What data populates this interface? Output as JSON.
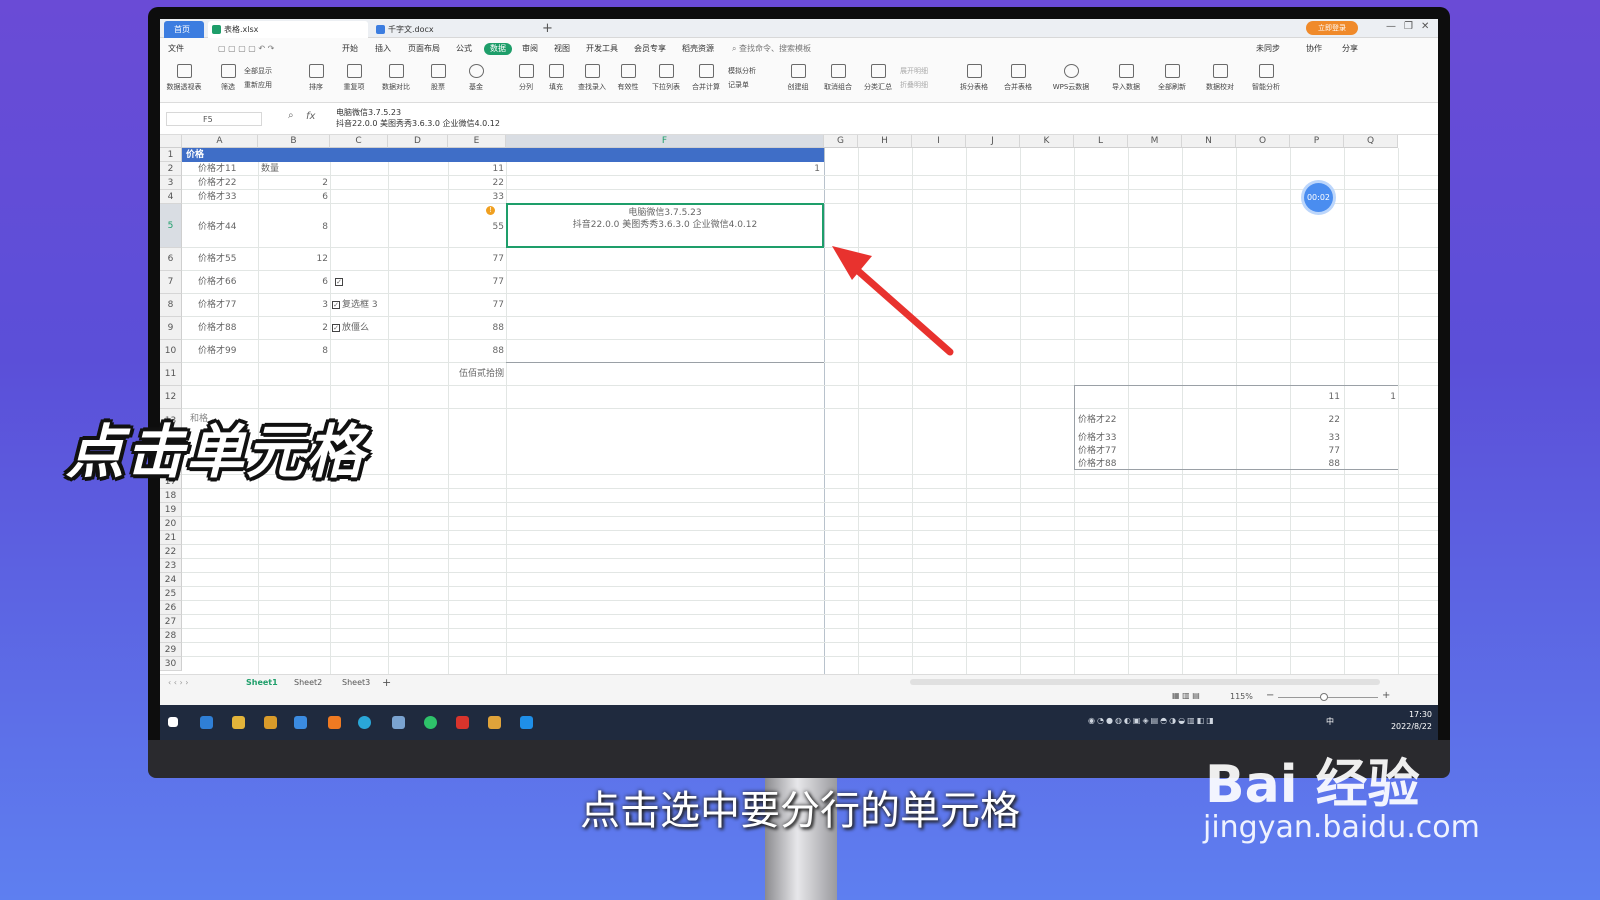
{
  "tabs": {
    "home": "首页",
    "xlsx": "表格.xlsx",
    "docx": "千字文.docx",
    "new_tab": "+"
  },
  "login": "立即登录",
  "menu": [
    "文件",
    "开始",
    "插入",
    "页面布局",
    "公式",
    "数据",
    "审阅",
    "视图",
    "开发工具",
    "会员专享",
    "稻壳资源"
  ],
  "menu_search": "查找命令、搜索模板",
  "menu_right": [
    "未同步",
    "协作",
    "分享"
  ],
  "ribbon": [
    "数据透视表",
    "筛选",
    "全部显示",
    "重新应用",
    "排序",
    "重复项",
    "数据对比",
    "股票",
    "基金",
    "分列",
    "填充",
    "查找录入",
    "有效性",
    "下拉列表",
    "合并计算",
    "模拟分析",
    "记录单",
    "创建组",
    "取消组合",
    "分类汇总",
    "展开明细",
    "折叠明细",
    "拆分表格",
    "合并表格",
    "WPS云数据",
    "导入数据",
    "全部刷新",
    "数据校对",
    "智能分析"
  ],
  "name_box": "F5",
  "formula": {
    "line1": "电脑微信3.7.5.23",
    "line2": "抖音22.0.0 美图秀秀3.6.3.0 企业微信4.0.12"
  },
  "columns": [
    "A",
    "B",
    "C",
    "D",
    "E",
    "F",
    "G",
    "H",
    "I",
    "J",
    "K",
    "L",
    "M",
    "N",
    "O",
    "P",
    "Q"
  ],
  "rows": [
    "1",
    "2",
    "3",
    "4",
    "5",
    "6",
    "7",
    "8",
    "9",
    "10",
    "11",
    "12",
    "13",
    "17",
    "18",
    "19",
    "20",
    "21",
    "22",
    "23",
    "24",
    "25",
    "26",
    "27",
    "28",
    "29",
    "30"
  ],
  "cells": {
    "title": "价格",
    "b2": "数量",
    "f2": "1",
    "a": [
      "价格才11",
      "价格才22",
      "价格才33",
      "价格才44",
      "价格才55",
      "价格才66",
      "价格才77",
      "价格才88",
      "价格才99"
    ],
    "b": [
      "",
      "2",
      "6",
      "8",
      "12",
      "6",
      "3",
      "2",
      "8"
    ],
    "e": [
      "11",
      "22",
      "33",
      "55",
      "77",
      "77",
      "77",
      "88",
      "88"
    ],
    "c8": "复选框 3",
    "c9": "放僵么",
    "e11": "伍佰贰拾捌",
    "f5_line1": "电脑微信3.7.5.23",
    "f5_line2": "抖音22.0.0 美图秀秀3.6.3.0 企业微信4.0.12",
    "a13": "和格",
    "p12": "11",
    "q12": "1",
    "side_labels": [
      "价格才22",
      "价格才33",
      "价格才77",
      "价格才88"
    ],
    "side_values": [
      "22",
      "33",
      "77",
      "88"
    ]
  },
  "timer": "00:02",
  "sheets": [
    "Sheet1",
    "Sheet2",
    "Sheet3"
  ],
  "zoom": "115%",
  "clock": {
    "time": "17:30",
    "date": "2022/8/22"
  },
  "taskbar_lang": "中",
  "caption_big": "点击单元格",
  "subtitle": "点击选中要分行的单元格",
  "watermark": {
    "brand": "Bai 经验",
    "url": "jingyan.baidu.com"
  },
  "colors": {
    "accent": "#1e9e6a",
    "title_band": "#3f6ec7",
    "arrow": "#e8322e"
  }
}
